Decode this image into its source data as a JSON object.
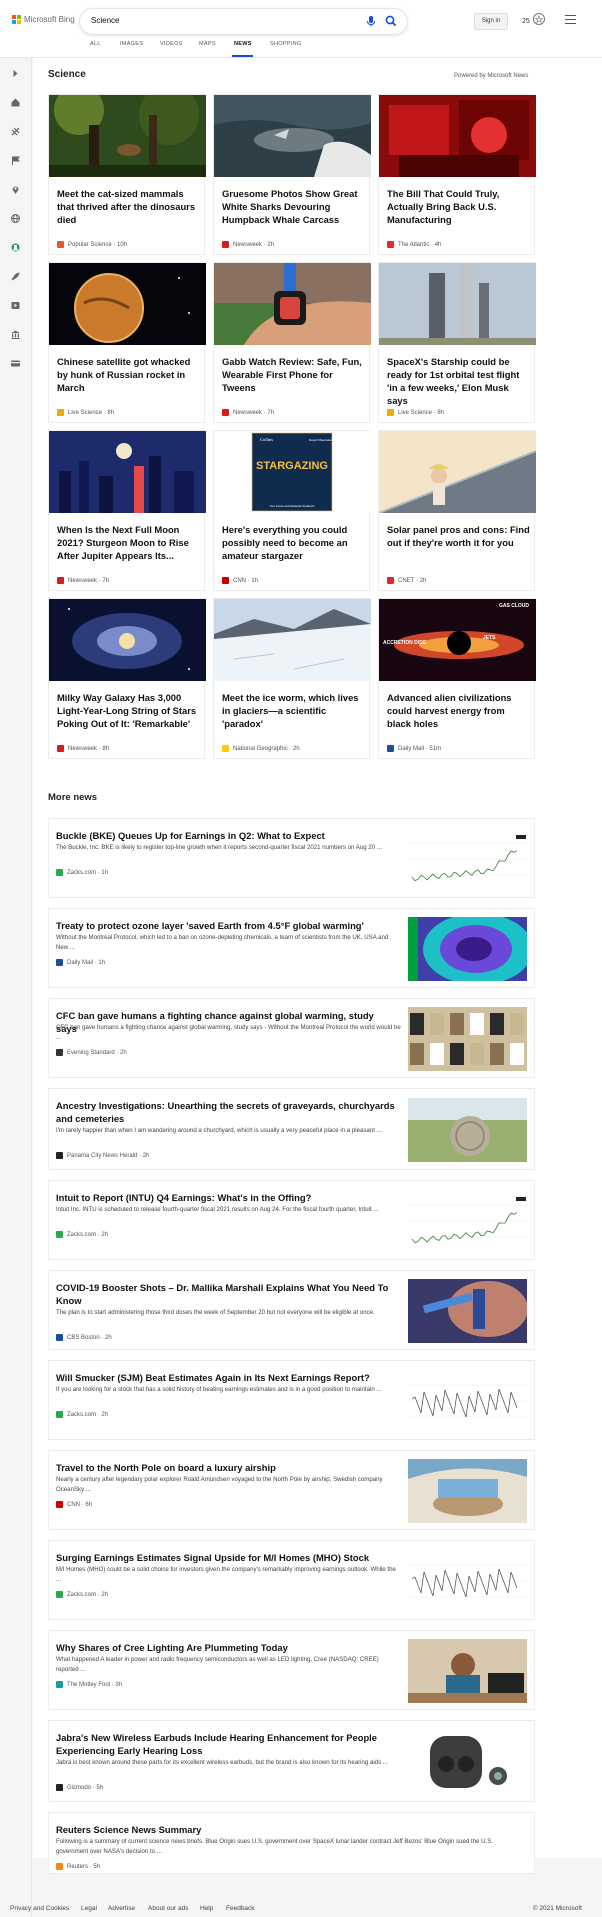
{
  "brand": {
    "name": "Microsoft Bing",
    "tile_colors": [
      "#f35325",
      "#81bc06",
      "#05a6f0",
      "#ffba08"
    ]
  },
  "search": {
    "query": "Science"
  },
  "header": {
    "signin_label": "Sign in",
    "rewards_count": "25",
    "accent_color": "#174ae4"
  },
  "scopes": [
    "ALL",
    "IMAGES",
    "VIDEOS",
    "MAPS",
    "NEWS",
    "SHOPPING"
  ],
  "active_scope": "NEWS",
  "rail_icons": [
    "expand-icon",
    "home-icon",
    "sports-icon",
    "flag-icon",
    "location-icon",
    "globe-icon",
    "science-icon",
    "rocket-icon",
    "video-icon",
    "bank-icon",
    "card-icon"
  ],
  "section": {
    "title": "Science",
    "powered_by": "Powered by Microsoft News"
  },
  "cards": [
    {
      "title": "Meet the cat-sized mammals that thrived after the dinosaurs died",
      "source": "Popular Science",
      "age": "10h",
      "logo_color": "#e8562a",
      "thumb": "forest"
    },
    {
      "title": "Gruesome Photos Show Great White Sharks Devouring Humpback Whale Carcass",
      "source": "Newsweek",
      "age": "2h",
      "logo_color": "#d81c1c",
      "thumb": "ocean"
    },
    {
      "title": "The Bill That Could Truly, Actually Bring Back U.S. Manufacturing",
      "source": "The Atlantic",
      "age": "4h",
      "logo_color": "#e52b2b",
      "thumb": "red-lab"
    },
    {
      "title": "Chinese satellite got whacked by hunk of Russian rocket in March",
      "source": "Live Science",
      "age": "8h",
      "logo_color": "#f2a900",
      "thumb": "earth"
    },
    {
      "title": "Gabb Watch Review: Safe, Fun, Wearable First Phone for Tweens",
      "source": "Newsweek",
      "age": "7h",
      "logo_color": "#d81c1c",
      "thumb": "watch"
    },
    {
      "title": "SpaceX's Starship could be ready for 1st orbital test flight 'in a few weeks,' Elon Musk says",
      "source": "Live Science",
      "age": "8h",
      "logo_color": "#f2a900",
      "thumb": "rocket"
    },
    {
      "title": "When Is the Next Full Moon 2021? Sturgeon Moon to Rise After Jupiter Appears Its...",
      "source": "Newsweek",
      "age": "7h",
      "logo_color": "#d81c1c",
      "thumb": "city-night"
    },
    {
      "title": "Here's everything you could possibly need to become an amateur stargazer",
      "source": "CNN",
      "age": "1h",
      "logo_color": "#cc0000",
      "thumb": "book"
    },
    {
      "title": "Solar panel pros and cons: Find out if they're worth it for you",
      "source": "CNET",
      "age": "2h",
      "logo_color": "#e5242b",
      "thumb": "solar"
    },
    {
      "title": "Milky Way Galaxy Has 3,000 Light-Year-Long String of Stars Poking Out of It: 'Remarkable'",
      "source": "Newsweek",
      "age": "8h",
      "logo_color": "#d81c1c",
      "thumb": "galaxy"
    },
    {
      "title": "Meet the ice worm, which lives in glaciers—a scientific 'paradox'",
      "source": "National Geographic",
      "age": "2h",
      "logo_color": "#ffce00",
      "thumb": "glacier"
    },
    {
      "title": "Advanced alien civilizations could harvest energy from black holes",
      "source": "Daily Mail",
      "age": "51m",
      "logo_color": "#1f4e9c",
      "thumb": "blackhole",
      "thumb_text": [
        "GAS CLOUD",
        "ACCRETION DISC",
        "JETS"
      ]
    }
  ],
  "book_cover": {
    "publisher": "Collins",
    "imprint": "Royal Observatory Greenwich",
    "title": "STARGAZING",
    "authors": "Tom Kerss and Radmila Topalovic"
  },
  "more_news_title": "More news",
  "news": [
    {
      "title": "Buckle (BKE) Queues Up for Earnings in Q2: What to Expect",
      "snippet": "The Buckle, Inc. BKE is likely to register top-line growth when it reports second-quarter fiscal 2021 numbers on Aug 20 ...",
      "source": "Zacks.com",
      "age": "1h",
      "logo_color": "#2aa84f",
      "thumb": "stock-chart"
    },
    {
      "title": "Treaty to protect ozone layer 'saved Earth from 4.5°F global warming'",
      "snippet": "Without the Montreal Protocol, which led to a ban on ozone-depleting chemicals, a team of scientists from the UK, USA and New ...",
      "source": "Daily Mail",
      "age": "1h",
      "logo_color": "#1f4e9c",
      "thumb": "ozone"
    },
    {
      "title": "CFC ban gave humans a fighting chance against global warming, study says",
      "snippet": "CFC ban gave humans a fighting chance against global warming, study says - Without the Montreal Protocol the world would be ...",
      "source": "Evening Standard",
      "age": "2h",
      "logo_color": "#333333",
      "thumb": "cans"
    },
    {
      "title": "Ancestry Investigations: Unearthing the secrets of graveyards, churchyards and cemeteries",
      "snippet": "I'm rarely happier than when I am wandering around a churchyard, which is usually a very peaceful place in a pleasant ...",
      "source": "Panama City News Herald",
      "age": "2h",
      "logo_color": "#222222",
      "thumb": "gravestone"
    },
    {
      "title": "Intuit to Report (INTU) Q4 Earnings: What's in the Offing?",
      "snippet": "Intuit Inc. INTU is scheduled to release fourth-quarter fiscal 2021 results on Aug 24. For the fiscal fourth quarter, Intuit ...",
      "source": "Zacks.com",
      "age": "2h",
      "logo_color": "#2aa84f",
      "thumb": "stock-chart"
    },
    {
      "title": "COVID-19 Booster Shots – Dr. Mallika Marshall Explains What You Need To Know",
      "snippet": "The plan is to start administering those third doses the week of September 20 but not everyone will be eligible at once.",
      "source": "CBS Boston",
      "age": "2h",
      "logo_color": "#1b4f9c",
      "thumb": "vaccine"
    },
    {
      "title": "Will Smucker (SJM) Beat Estimates Again in Its Next Earnings Report?",
      "snippet": "If you are looking for a stock that has a solid history of beating earnings estimates and is in a good position to maintain ...",
      "source": "Zacks.com",
      "age": "2h",
      "logo_color": "#2aa84f",
      "thumb": "stock-zigzag"
    },
    {
      "title": "Travel to the North Pole on board a luxury airship",
      "snippet": "Nearly a century after legendary polar explorer Roald Amundsen voyaged to the North Pole by airship, Swedish company OceanSky ...",
      "source": "CNN",
      "age": "6h",
      "logo_color": "#cc0000",
      "thumb": "airship"
    },
    {
      "title": "Surging Earnings Estimates Signal Upside for M/I Homes (MHO) Stock",
      "snippet": "M/I Homes (MHO) could be a solid choice for investors given the company's remarkably improving earnings outlook. While the ...",
      "source": "Zacks.com",
      "age": "2h",
      "logo_color": "#2aa84f",
      "thumb": "stock-zigzag"
    },
    {
      "title": "Why Shares of Cree Lighting Are Plummeting Today",
      "snippet": "What happened A leader in power and radio frequency semiconductors as well as LED lighting, Cree (NASDAQ: CREE) reported ...",
      "source": "The Motley Fool",
      "age": "3h",
      "logo_color": "#1a9fa0",
      "thumb": "stressed"
    },
    {
      "title": "Jabra's New Wireless Earbuds Include Hearing Enhancement for People Experiencing Early Hearing Loss",
      "snippet": "Jabra is best known around these parts for its excellent wireless earbuds, but the brand is also known for its hearing aids ...",
      "source": "Gizmodo",
      "age": "5h",
      "logo_color": "#222222",
      "thumb": "earbuds"
    },
    {
      "title": "Reuters Science News Summary",
      "snippet": "Following is a summary of current science news briefs. Blue Origin sues U.S. government over SpaceX lunar lander contract Jeff Bezos' Blue Origin sued the U.S. government over NASA's decision to ...",
      "source": "Reuters",
      "age": "5h",
      "logo_color": "#f28a1b",
      "thumb": ""
    }
  ],
  "footer": {
    "links": [
      "Privacy and Cookies",
      "Legal",
      "Advertise",
      "About our ads",
      "Help",
      "Feedback"
    ],
    "copyright": "© 2021 Microsoft"
  }
}
